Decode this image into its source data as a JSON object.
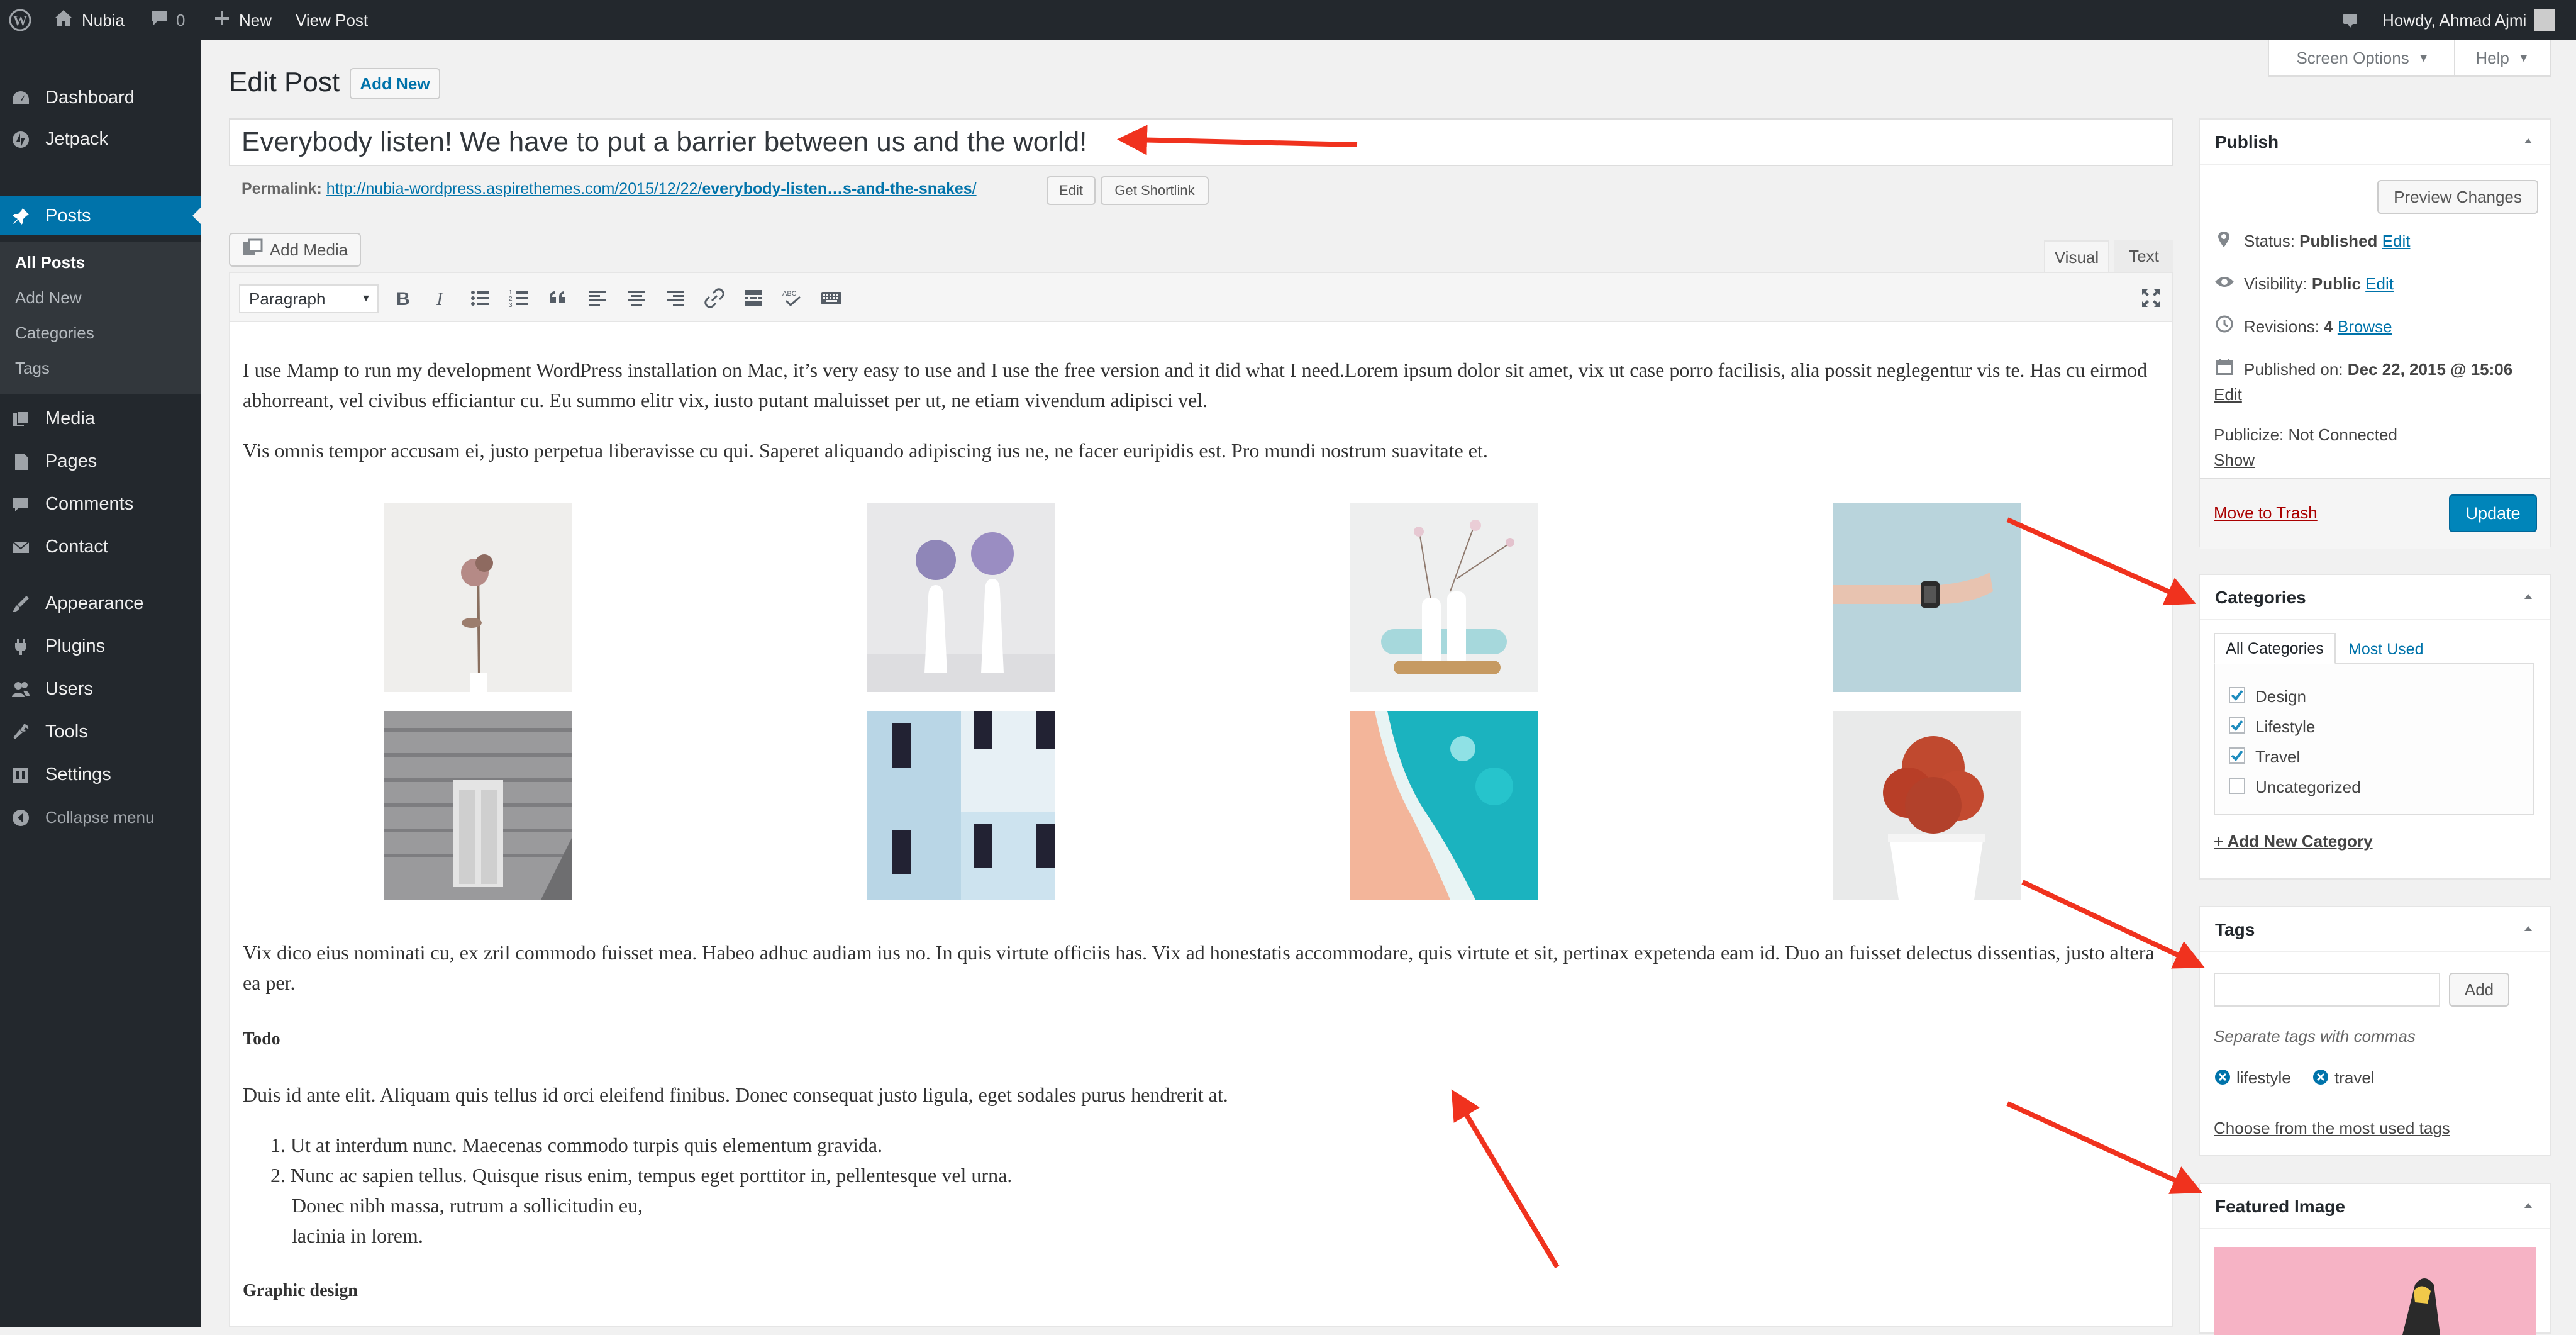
{
  "adminbar": {
    "site_name": "Nubia",
    "comments_count": "0",
    "new_label": "New",
    "view_post_label": "View Post",
    "howdy": "Howdy, Ahmad Ajmi"
  },
  "sidebar": {
    "items": [
      {
        "label": "Dashboard",
        "icon": "dashboard-icon"
      },
      {
        "label": "Jetpack",
        "icon": "jetpack-icon"
      },
      {
        "label": "Posts",
        "icon": "pin-icon"
      },
      {
        "label": "Media",
        "icon": "media-icon"
      },
      {
        "label": "Pages",
        "icon": "pages-icon"
      },
      {
        "label": "Comments",
        "icon": "comments-icon"
      },
      {
        "label": "Contact",
        "icon": "mail-icon"
      },
      {
        "label": "Appearance",
        "icon": "brush-icon"
      },
      {
        "label": "Plugins",
        "icon": "plug-icon"
      },
      {
        "label": "Users",
        "icon": "users-icon"
      },
      {
        "label": "Tools",
        "icon": "wrench-icon"
      },
      {
        "label": "Settings",
        "icon": "settings-icon"
      },
      {
        "label": "Collapse menu",
        "icon": "collapse-icon"
      }
    ],
    "posts_sub": [
      "All Posts",
      "Add New",
      "Categories",
      "Tags"
    ]
  },
  "screen_options": "Screen Options",
  "help": "Help",
  "page_title": "Edit Post",
  "add_new_btn": "Add New",
  "post_title": "Everybody listen! We have to put a barrier between us and the world!",
  "permalink": {
    "label": "Permalink:",
    "url_prefix": "http://nubia-wordpress.aspirethemes.com/2015/12/22/",
    "url_slug": "everybody-listen…s-and-the-snakes",
    "url_suffix": "/",
    "edit_btn": "Edit",
    "shortlink_btn": "Get Shortlink"
  },
  "add_media": "Add Media",
  "editor_tabs": {
    "visual": "Visual",
    "text": "Text"
  },
  "format_select": "Paragraph",
  "content": {
    "p1": "I use Mamp to run my development WordPress installation on Mac, it’s very easy to use and I use the free version and it did what I need.Lorem ipsum dolor sit amet, vix ut case porro facilisis, alia possit neglegentur vis te. Has cu eirmod abhorreant, vel civibus efficiantur cu. Eu summo elitr vix, iusto putant maluisset per ut, ne etiam vivendum adipisci vel.",
    "p2": "Vis omnis tempor accusam ei, justo perpetua liberavisse cu qui. Saperet aliquando adipiscing ius ne, ne facer euripidis est. Pro mundi nostrum suavitate et.",
    "p3": "Vix dico eius nominati cu, ex zril commodo fuisset mea. Habeo adhuc audiam ius no. In quis virtute officiis has. Vix ad honestatis accommodare, quis virtute et sit, pertinax expetenda eam id. Duo an fuisset delectus dissentias, justo altera ea per.",
    "h_todo": "Todo",
    "p4": "Duis id ante elit. Aliquam quis tellus id orci eleifend finibus. Donec consequat justo ligula, eget sodales purus hendrerit at.",
    "li1": "Ut at interdum nunc. Maecenas commodo turpis quis elementum gravida.",
    "li2": "Nunc ac sapien tellus. Quisque risus enim, tempus eget porttitor in, pellentesque vel urna.",
    "li2b": "Donec nibh massa, rutrum a sollicitudin eu,",
    "li2c": "lacinia in lorem.",
    "h_graphic": "Graphic design",
    "gallery_images": [
      "dried-flower",
      "vases-purple-flowers",
      "vases-blossom",
      "hand-watch",
      "building-door",
      "blue-building",
      "ocean-waves",
      "red-cactus"
    ]
  },
  "publish": {
    "title": "Publish",
    "preview_btn": "Preview Changes",
    "status_label": "Status:",
    "status_value": "Published",
    "visibility_label": "Visibility:",
    "visibility_value": "Public",
    "revisions_label": "Revisions:",
    "revisions_value": "4",
    "browse": "Browse",
    "published_on_label": "Published on:",
    "published_on_value": "Dec 22, 2015 @ 15:06",
    "edit": "Edit",
    "publicize": "Publicize: Not Connected",
    "show": "Show",
    "trash": "Move to Trash",
    "update_btn": "Update"
  },
  "categories": {
    "title": "Categories",
    "tab_all": "All Categories",
    "tab_most": "Most Used",
    "items": [
      {
        "label": "Design",
        "checked": true
      },
      {
        "label": "Lifestyle",
        "checked": true
      },
      {
        "label": "Travel",
        "checked": true
      },
      {
        "label": "Uncategorized",
        "checked": false
      }
    ],
    "add_new": "+ Add New Category"
  },
  "tags": {
    "title": "Tags",
    "add_btn": "Add",
    "hint": "Separate tags with commas",
    "items": [
      "lifestyle",
      "travel"
    ],
    "choose": "Choose from the most used tags"
  },
  "featured_image": {
    "title": "Featured Image"
  },
  "colors": {
    "accent": "#0073aa",
    "sidebar": "#23282d",
    "arrow": "#f0321e"
  }
}
